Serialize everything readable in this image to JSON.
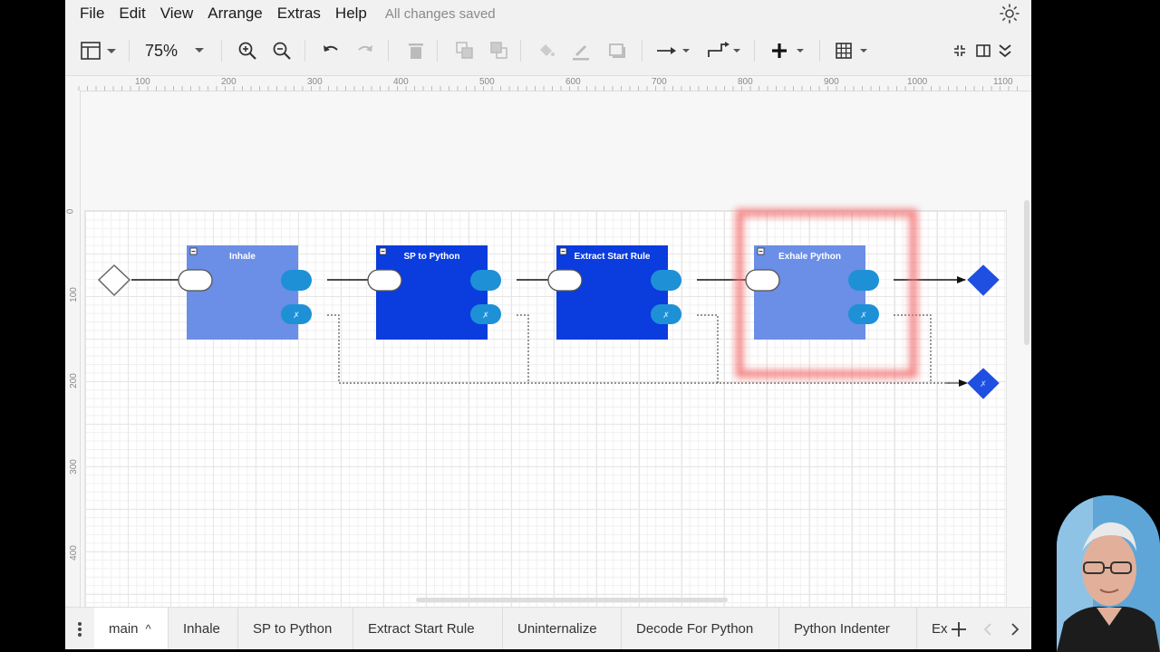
{
  "menubar": {
    "items": [
      "File",
      "Edit",
      "View",
      "Arrange",
      "Extras",
      "Help"
    ],
    "status": "All changes saved"
  },
  "toolbar": {
    "zoom": "75%",
    "icons": [
      "format-panel-icon",
      "zoom-in-icon",
      "zoom-out-icon",
      "undo-icon",
      "redo-icon",
      "delete-icon",
      "to-front-icon",
      "to-back-icon",
      "fill-color-icon",
      "line-color-icon",
      "shadow-icon",
      "connection-icon",
      "waypoints-icon",
      "insert-plus-icon",
      "table-icon",
      "collapse-icon",
      "panel-toggle-icon",
      "more-icon"
    ]
  },
  "rulers": {
    "horizontal": [
      "100",
      "200",
      "300",
      "400",
      "500",
      "600",
      "700",
      "800",
      "900",
      "1000",
      "1100"
    ],
    "vertical": [
      "0",
      "100",
      "200",
      "300",
      "400"
    ]
  },
  "diagram": {
    "boxes": [
      {
        "label": "Inhale",
        "color": "#6b8ee6"
      },
      {
        "label": "SP to Python",
        "color": "#0a3cde"
      },
      {
        "label": "Extract Start Rule",
        "color": "#0a3cde"
      },
      {
        "label": "Exhale Python",
        "color": "#6b8ee6"
      }
    ],
    "highlight_color": "#f28b8b",
    "port_color": "#1e90d6",
    "end_color": "#1f4fe0",
    "error_port_glyph": "✗"
  },
  "tabs": {
    "items": [
      "main",
      "Inhale",
      "SP to Python",
      "Extract Start Rule",
      "Uninternalize",
      "Decode For Python",
      "Python Indenter",
      "Ex"
    ],
    "active": "main",
    "active_caret": "^"
  }
}
